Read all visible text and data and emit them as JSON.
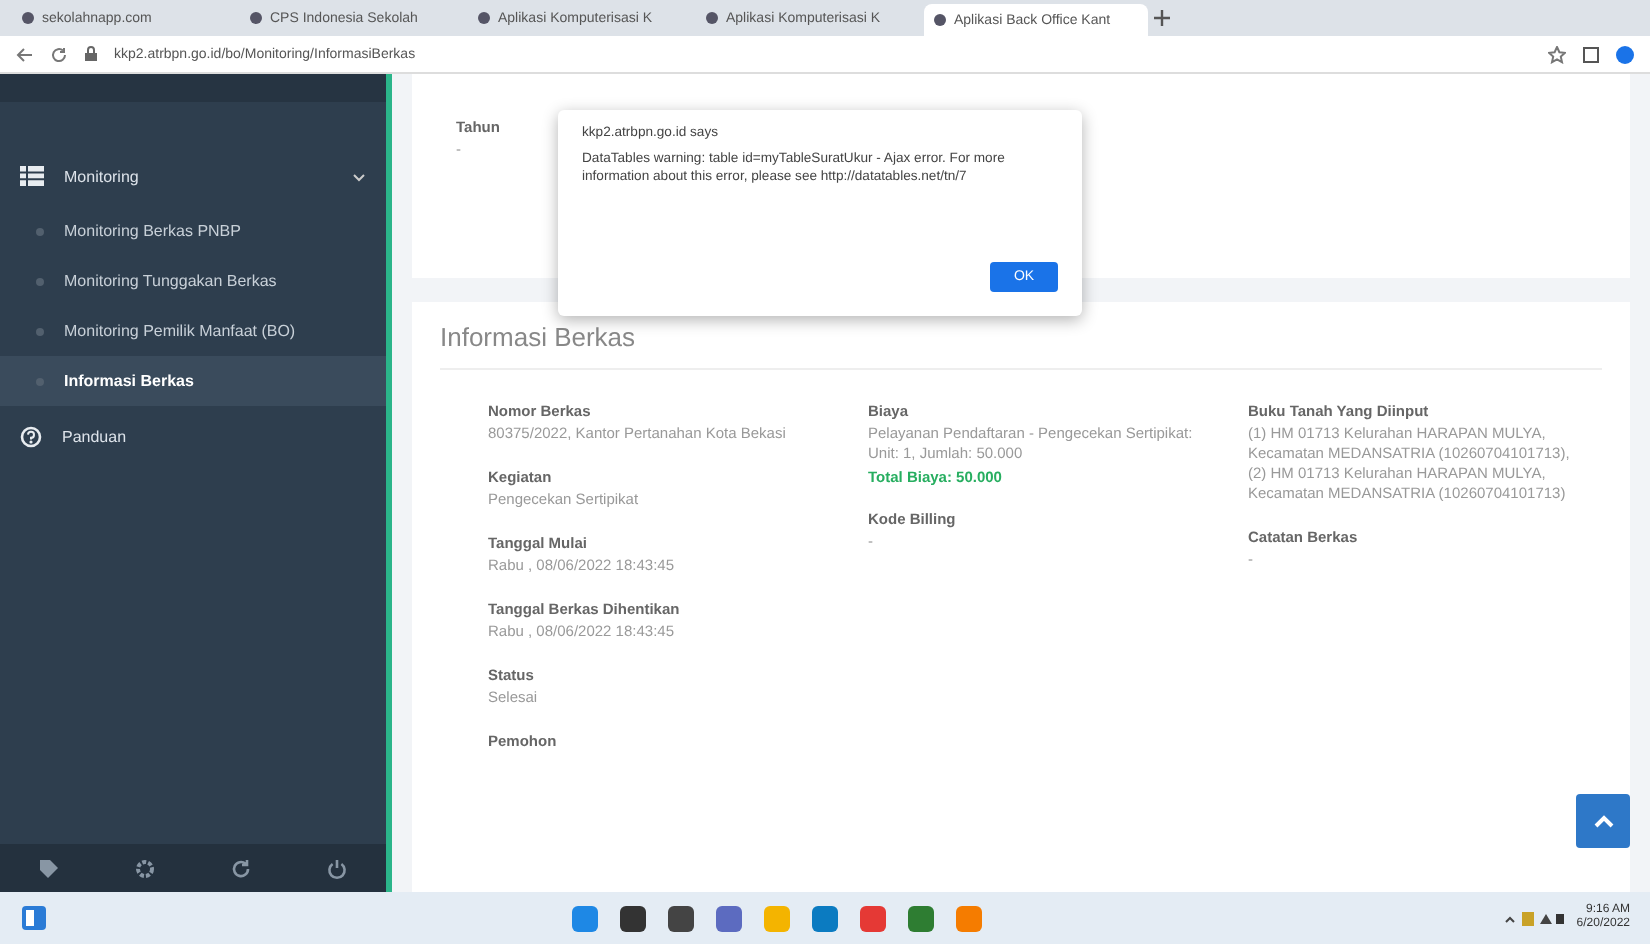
{
  "browser": {
    "tabs": [
      {
        "title": "sekolahnapp.com",
        "selected": false
      },
      {
        "title": "CPS Indonesia Sekolah",
        "selected": false
      },
      {
        "title": "Aplikasi Komputerisasi K",
        "selected": false
      },
      {
        "title": "Aplikasi Komputerisasi K",
        "selected": false
      },
      {
        "title": "Aplikasi Back Office Kant",
        "selected": true
      }
    ],
    "address": "kkp2.atrbpn.go.id/bo/Monitoring/InformasiBerkas"
  },
  "sidebar": {
    "items": [
      {
        "label": "Monitoring",
        "expanded": true,
        "children": [
          {
            "label": "Monitoring Berkas PNBP",
            "selected": false
          },
          {
            "label": "Monitoring Tunggakan Berkas",
            "selected": false
          },
          {
            "label": "Monitoring Pemilik Manfaat (BO)",
            "selected": false
          },
          {
            "label": "Informasi Berkas",
            "selected": true
          }
        ]
      },
      {
        "label": "Panduan"
      }
    ]
  },
  "top_card": {
    "label": "Tahun",
    "value": "-"
  },
  "dialog": {
    "title": "kkp2.atrbpn.go.id says",
    "message": "DataTables warning: table id=myTableSuratUkur - Ajax error. For more information about this error, please see http://datatables.net/tn/7",
    "button": "OK"
  },
  "card": {
    "title": "Informasi Berkas",
    "columns": [
      [
        {
          "kind": "field",
          "label": "Nomor Berkas",
          "value": "80375/2022, Kantor Pertanahan Kota Bekasi"
        },
        {
          "kind": "field",
          "label": "Kegiatan",
          "value": "Pengecekan Sertipikat"
        },
        {
          "kind": "field",
          "label": "Tanggal Mulai",
          "value": "Rabu , 08/06/2022 18:43:45"
        },
        {
          "kind": "field",
          "label": "Tanggal Berkas Dihentikan",
          "value": "Rabu , 08/06/2022 18:43:45"
        },
        {
          "kind": "field",
          "label": "Status",
          "value": "Selesai"
        },
        {
          "kind": "field",
          "label": "Pemohon"
        }
      ],
      [
        {
          "kind": "field",
          "label": "Biaya",
          "value": "Pelayanan Pendaftaran - Pengecekan Sertipikat: Unit: 1, Jumlah: 50.000"
        },
        {
          "kind": "total",
          "text": "Total Biaya: 50.000"
        },
        {
          "kind": "field",
          "label": "Kode Billing",
          "value": "-"
        }
      ],
      [
        {
          "kind": "field",
          "label": "Buku Tanah Yang Diinput",
          "value": "(1) HM 01713 Kelurahan HARAPAN MULYA, Kecamatan MEDANSATRIA (10260704101713), (2) HM 01713 Kelurahan HARAPAN MULYA, Kecamatan MEDANSATRIA (10260704101713)"
        },
        {
          "kind": "field",
          "label": "Catatan Berkas",
          "value": "-"
        }
      ]
    ]
  },
  "taskbar": {
    "time": "9:16 AM",
    "date": "6/20/2022"
  }
}
